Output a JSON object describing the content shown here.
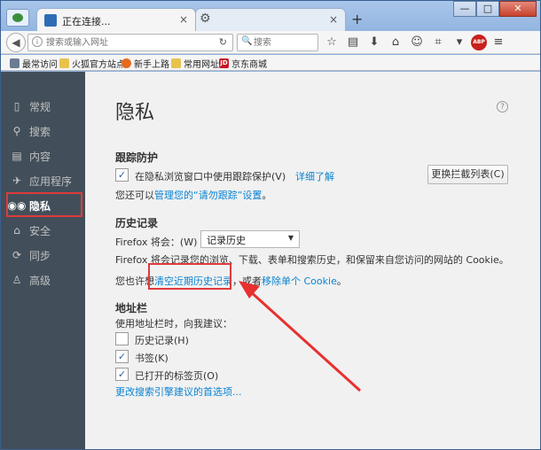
{
  "window": {
    "active_tab_title": "正在连接...",
    "new_tab_symbol": "+",
    "minimize": "—",
    "maximize": "□",
    "close": "✕"
  },
  "navbar": {
    "url_placeholder": "搜索或输入网址",
    "search_placeholder": "搜索"
  },
  "bookmarks": [
    {
      "label": "最常访问",
      "icon": "gear-icon"
    },
    {
      "label": "火狐官方站点",
      "icon": "folder-icon"
    },
    {
      "label": "新手上路",
      "icon": "firefox-icon"
    },
    {
      "label": "常用网址",
      "icon": "folder-icon"
    },
    {
      "label": "京东商城",
      "icon": "jd-icon",
      "icon_text": "JD"
    }
  ],
  "toolbar_extras": {
    "abp_text": "ABP"
  },
  "sidebar": {
    "items": [
      {
        "label": "常规",
        "icon": "general-icon"
      },
      {
        "label": "搜索",
        "icon": "search-icon"
      },
      {
        "label": "内容",
        "icon": "content-icon"
      },
      {
        "label": "应用程序",
        "icon": "applications-icon"
      },
      {
        "label": "隐私",
        "icon": "mask-icon",
        "selected": true
      },
      {
        "label": "安全",
        "icon": "lock-icon"
      },
      {
        "label": "同步",
        "icon": "sync-icon"
      },
      {
        "label": "高级",
        "icon": "advanced-icon"
      }
    ]
  },
  "privacy": {
    "title": "隐私",
    "help": "?",
    "tracking": {
      "heading": "跟踪防护",
      "checkbox_label": "在隐私浏览窗口中使用跟踪保护(V)",
      "checked": true,
      "learn_more": "详细了解",
      "change_blocklist_button": "更换拦截列表(C)",
      "dnt_prefix": "您还可以",
      "dnt_link": "管理您的“请勿跟踪”设置",
      "dnt_suffix": "。"
    },
    "history": {
      "heading": "历史记录",
      "firefox_will": "Firefox 将会：(W)",
      "mode_selected": "记录历史",
      "description": "Firefox 将会记录您的浏览、下载、表单和搜索历史，和保留来自您访问的网站的 Cookie。",
      "clear_prefix": "您也许想",
      "clear_link": "清空近期历史记录",
      "clear_middle": "，或者",
      "remove_cookie_link": "移除单个 Cookie",
      "clear_suffix": "。"
    },
    "location_bar": {
      "heading": "地址栏",
      "suggest_label": "使用地址栏时，向我建议：",
      "options": [
        {
          "label": "历史记录(H)",
          "checked": false
        },
        {
          "label": "书签(K)",
          "checked": true
        },
        {
          "label": "已打开的标签页(O)",
          "checked": true
        }
      ],
      "change_search_link": "更改搜索引擎建议的首选项..."
    }
  },
  "colors": {
    "link": "#0a84d2",
    "sidebar_bg": "#424f5a",
    "highlight": "#e03a3a",
    "content_bg": "#f1f1f1"
  }
}
